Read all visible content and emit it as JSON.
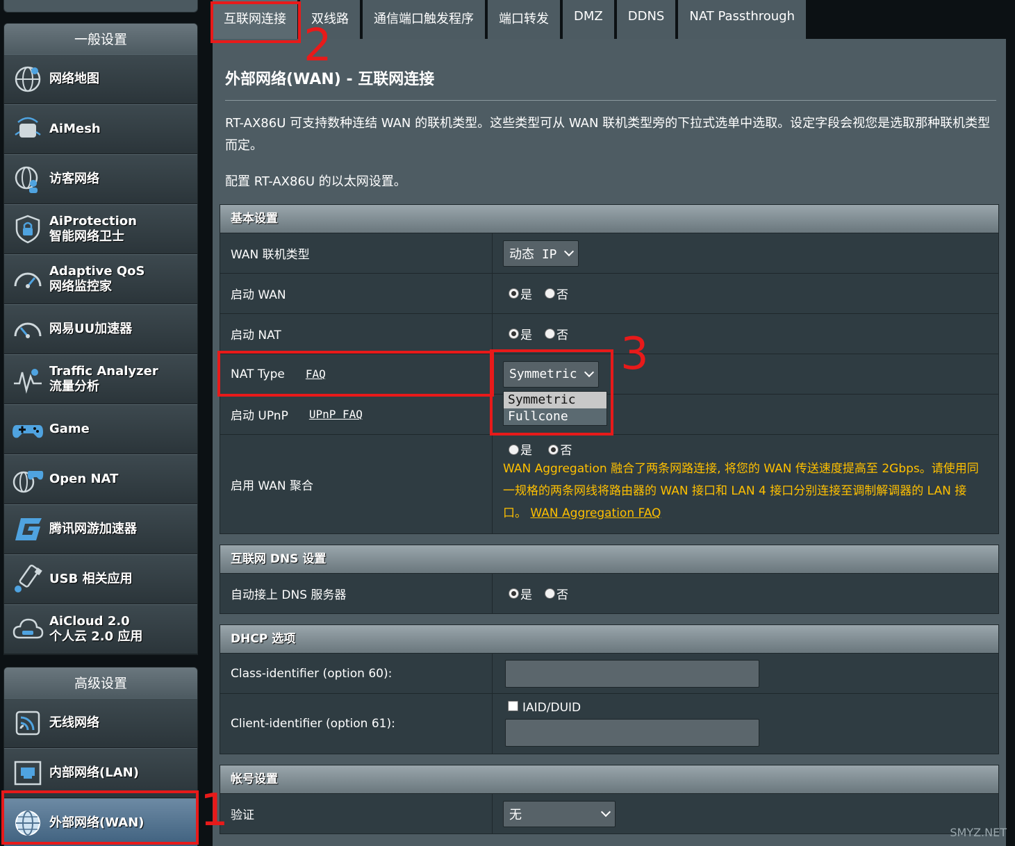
{
  "sidebar": {
    "general_header": "一般设置",
    "advanced_header": "高级设置",
    "general_items": [
      {
        "icon": "network-map-icon",
        "l1": "网络地图",
        "l2": ""
      },
      {
        "icon": "aimesh-icon",
        "l1": "AiMesh",
        "l2": ""
      },
      {
        "icon": "guest-network-icon",
        "l1": "访客网络",
        "l2": ""
      },
      {
        "icon": "shield-lock-icon",
        "l1": "AiProtection",
        "l2": "智能网络卫士"
      },
      {
        "icon": "speedometer-icon",
        "l1": "Adaptive QoS",
        "l2": "网络监控家"
      },
      {
        "icon": "gauge-icon",
        "l1": "网易UU加速器",
        "l2": ""
      },
      {
        "icon": "traffic-analyzer-icon",
        "l1": "Traffic Analyzer",
        "l2": "流量分析"
      },
      {
        "icon": "gamepad-icon",
        "l1": "Game",
        "l2": ""
      },
      {
        "icon": "open-nat-icon",
        "l1": "Open NAT",
        "l2": ""
      },
      {
        "icon": "tencent-accelerator-icon",
        "l1": "腾讯网游加速器",
        "l2": ""
      },
      {
        "icon": "usb-icon",
        "l1": "USB 相关应用",
        "l2": ""
      },
      {
        "icon": "cloud-icon",
        "l1": "AiCloud 2.0",
        "l2": "个人云 2.0 应用"
      }
    ],
    "advanced_items": [
      {
        "icon": "wireless-icon",
        "l1": "无线网络"
      },
      {
        "icon": "lan-port-icon",
        "l1": "内部网络(LAN)"
      },
      {
        "icon": "globe-icon",
        "l1": "外部网络(WAN)"
      }
    ]
  },
  "tabs": [
    "互联网连接",
    "双线路",
    "通信端口触发程序",
    "端口转发",
    "DMZ",
    "DDNS",
    "NAT Passthrough"
  ],
  "main": {
    "title": "外部网络(WAN) - 互联网连接",
    "desc": "RT-AX86U 可支持数种连结 WAN 的联机类型。这些类型可从 WAN 联机类型旁的下拉式选单中选取。设定字段会视您是选取那种联机类型而定。",
    "desc2": "配置 RT-AX86U 的以太网设置。"
  },
  "basic": {
    "header": "基本设置",
    "wan_type_label": "WAN 联机类型",
    "wan_type_value": "动态 IP",
    "enable_wan_label": "启动 WAN",
    "enable_nat_label": "启动 NAT",
    "nat_type_label": "NAT Type",
    "nat_type_faq": "FAQ",
    "nat_type_value": "Symmetric",
    "upnp_label": "启动 UPnP",
    "upnp_faq": "UPnP  FAQ",
    "aggregation_label": "启用 WAN 聚合",
    "aggregation_warn": "WAN Aggregation 融合了两条网路连接, 将您的 WAN 传送速度提高至 2Gbps。请使用同一规格的两条网线将路由器的 WAN 接口和 LAN 4 接口分别连接至调制解调器的 LAN 接口。",
    "aggregation_faq": "WAN Aggregation FAQ",
    "yes": "是",
    "no": "否"
  },
  "nat_dropdown": [
    "Symmetric",
    "Fullcone"
  ],
  "dns": {
    "header": "互联网 DNS 设置",
    "auto_label": "自动接上 DNS 服务器"
  },
  "dhcp": {
    "header": "DHCP 选项",
    "class_label": "Class-identifier (option 60):",
    "client_label": "Client-identifier (option 61):",
    "iaid": "IAID/DUID"
  },
  "account": {
    "header": "帐号设置",
    "auth_label": "验证",
    "auth_value": "无"
  },
  "annotations": [
    "1",
    "2",
    "3"
  ],
  "watermark": "SMYZ.NET",
  "colors": {
    "highlight": "#e81a1a",
    "warning": "#ffc000",
    "active_item": "#4f7291"
  }
}
